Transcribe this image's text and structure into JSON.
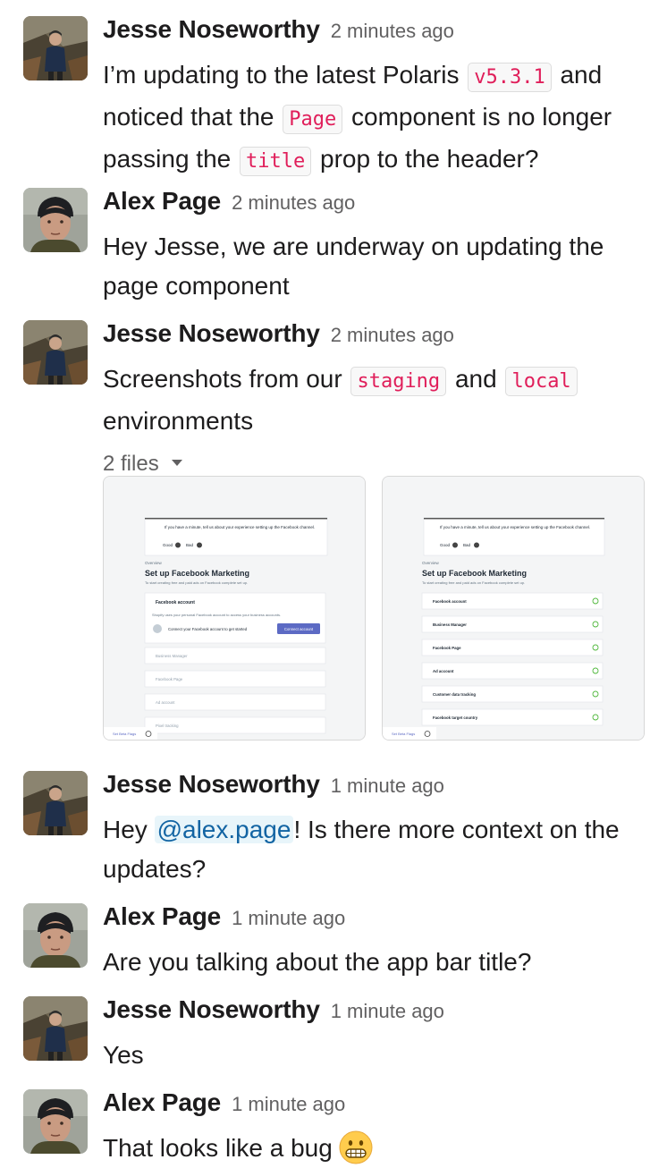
{
  "messages": [
    {
      "author": "Jesse Noseworthy",
      "time": "2 minutes ago",
      "avatar": "jesse-avatar",
      "parts": [
        "I’m updating to the latest Polaris ",
        "v5.3.1",
        " and noticed that the ",
        "Page",
        " component is no longer passing the ",
        "title",
        " prop to the header?"
      ]
    },
    {
      "author": "Alex Page",
      "time": "2 minutes ago",
      "avatar": "alex-avatar",
      "text": "Hey Jesse, we are underway on updating the page component"
    },
    {
      "author": "Jesse Noseworthy",
      "time": "2 minutes ago",
      "avatar": "jesse-avatar",
      "parts": [
        "Screenshots from our ",
        "staging",
        " and ",
        "local",
        " environments"
      ],
      "files_label": "2 files",
      "attachments": [
        {
          "name": "staging-screenshot",
          "banner": "If you have a minute, tell us about your experience setting up the Facebook channel.",
          "good": "Good",
          "bad": "Bad",
          "back": "Overview",
          "title": "Set up Facebook Marketing",
          "subtitle": "To start creating free and paid ads on Facebook complete set up.",
          "section": "Facebook account",
          "section_desc": "Shopify uses your personal Facebook account to access your business accounts.",
          "connect_text": "Connect your Facebook account to get started",
          "connect_button": "Connect account",
          "rows": [
            "Business Manager",
            "Facebook Page",
            "Ad account",
            "Pixel tracking"
          ],
          "footer": "Set Beta Flags"
        },
        {
          "name": "local-screenshot",
          "banner": "If you have a minute, tell us about your experience setting up the Facebook channel.",
          "good": "Good",
          "bad": "Bad",
          "back": "Overview",
          "title": "Set up Facebook Marketing",
          "subtitle": "To start creating free and paid ads on Facebook complete set up.",
          "rows": [
            "Facebook account",
            "Business Manager",
            "Facebook Page",
            "Ad account",
            "Customer data tracking",
            "Facebook target country"
          ],
          "footer": "Set Beta Flags"
        }
      ]
    },
    {
      "author": "Jesse Noseworthy",
      "time": "1 minute ago",
      "avatar": "jesse-avatar",
      "parts": [
        "Hey ",
        "@alex.page",
        "! Is there more context on the updates?"
      ]
    },
    {
      "author": "Alex Page",
      "time": "1 minute ago",
      "avatar": "alex-avatar",
      "text": "Are you talking about the app bar title?"
    },
    {
      "author": "Jesse Noseworthy",
      "time": "1 minute ago",
      "avatar": "jesse-avatar",
      "text": "Yes"
    },
    {
      "author": "Alex Page",
      "time": "1 minute ago",
      "avatar": "alex-avatar",
      "text": "That looks like a bug",
      "emoji": "grimacing-face-emoji"
    }
  ],
  "colors": {
    "code_text": "#e01e5a",
    "mention_text": "#1264a3",
    "mention_bg": "#e8f5fa",
    "primary_button": "#5c6ac4",
    "check_green": "#50b83c"
  }
}
